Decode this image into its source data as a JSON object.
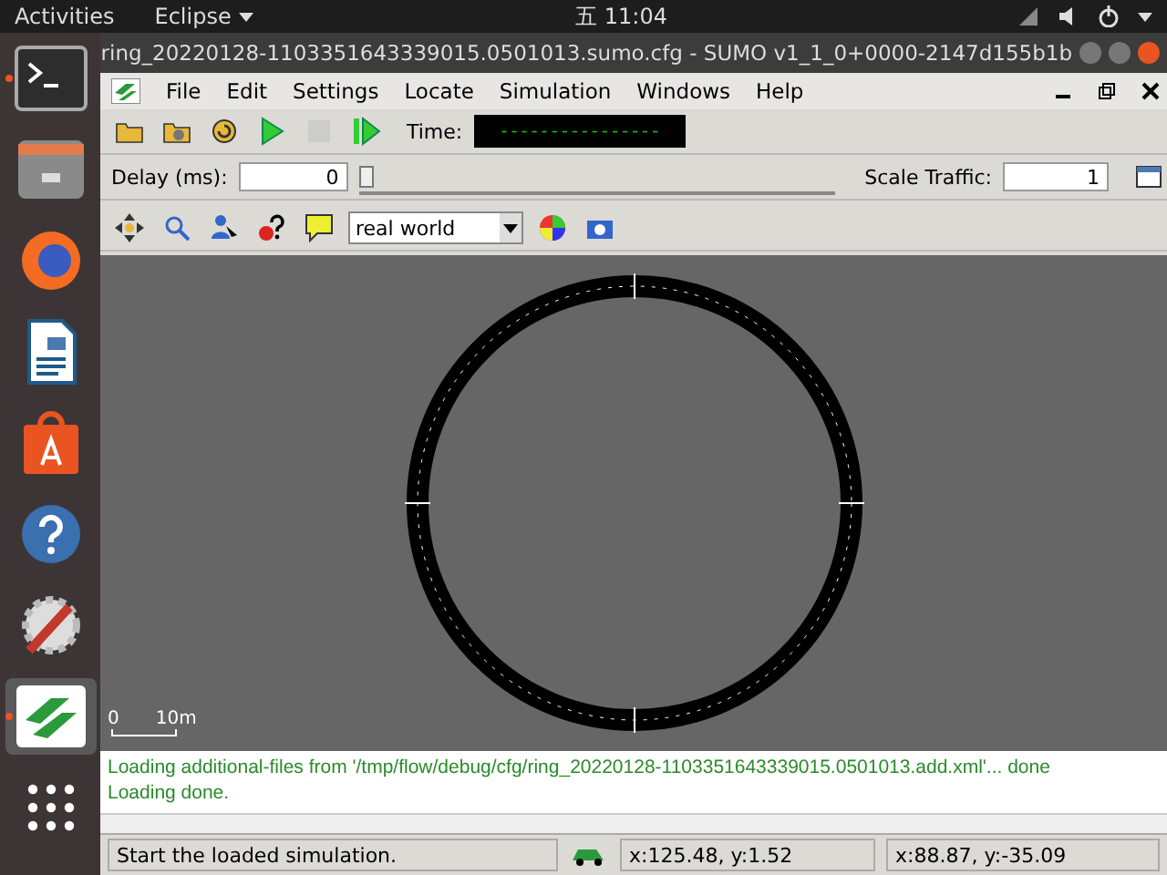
{
  "top_bar": {
    "activities": "Activities",
    "app": "Eclipse",
    "clock": "五 11:04"
  },
  "dock": [
    {
      "kind": "terminal",
      "running": true
    },
    {
      "kind": "files",
      "running": false
    },
    {
      "kind": "browser",
      "running": false
    },
    {
      "kind": "writer",
      "running": false
    },
    {
      "kind": "store",
      "running": false
    },
    {
      "kind": "help",
      "running": false
    },
    {
      "kind": "settings",
      "running": false
    },
    {
      "kind": "sumo",
      "running": true
    },
    {
      "kind": "apps",
      "running": false
    }
  ],
  "window": {
    "title": "ring_20220128-1103351643339015.0501013.sumo.cfg - SUMO v1_1_0+0000-2147d155b1b"
  },
  "menu": [
    "File",
    "Edit",
    "Settings",
    "Locate",
    "Simulation",
    "Windows",
    "Help"
  ],
  "toolbar": {
    "time_label": "Time:",
    "time_value": "----------------",
    "delay_label": "Delay (ms):",
    "delay_value": "0",
    "delay_slider": {
      "level": 0
    },
    "scale_label": "Scale Traffic:",
    "scale_value": "1"
  },
  "view_toolbar": {
    "scheme": "real world"
  },
  "canvas": {
    "scale_start": "0",
    "scale_end": "10m"
  },
  "log": [
    "Loading additional-files from '/tmp/flow/debug/cfg/ring_20220128-1103351643339015.0501013.add.xml'... done",
    "Loading done."
  ],
  "status_bar": {
    "message": "Start the loaded simulation.",
    "cursor_coords": "x:125.48, y:1.52",
    "geo_coords": "x:88.87, y:-35.09"
  }
}
